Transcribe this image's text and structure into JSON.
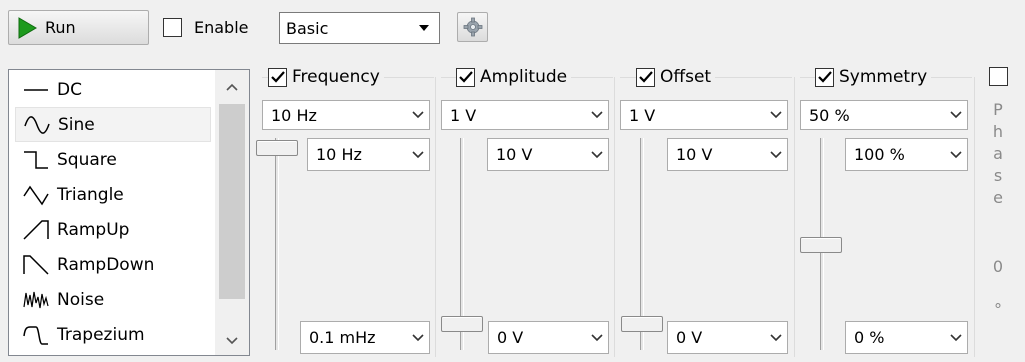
{
  "toolbar": {
    "run_label": "Run",
    "enable_label": "Enable",
    "enable_checked": false,
    "mode_value": "Basic"
  },
  "waveforms": {
    "items": [
      {
        "label": "DC",
        "icon": "dc-wave-icon",
        "selected": false
      },
      {
        "label": "Sine",
        "icon": "sine-wave-icon",
        "selected": true
      },
      {
        "label": "Square",
        "icon": "square-wave-icon",
        "selected": false
      },
      {
        "label": "Triangle",
        "icon": "triangle-wave-icon",
        "selected": false
      },
      {
        "label": "RampUp",
        "icon": "ramp-up-wave-icon",
        "selected": false
      },
      {
        "label": "RampDown",
        "icon": "ramp-down-wave-icon",
        "selected": false
      },
      {
        "label": "Noise",
        "icon": "noise-wave-icon",
        "selected": false
      },
      {
        "label": "Trapezium",
        "icon": "trapezium-wave-icon",
        "selected": false
      }
    ]
  },
  "params": {
    "frequency": {
      "label": "Frequency",
      "checked": true,
      "value": "10 Hz",
      "max": "10 Hz",
      "min": "0.1 mHz",
      "level": 1.0
    },
    "amplitude": {
      "label": "Amplitude",
      "checked": true,
      "value": "1 V",
      "max": "10 V",
      "min": "0 V",
      "level": 0.1
    },
    "offset": {
      "label": "Offset",
      "checked": true,
      "value": "1 V",
      "max": "10 V",
      "min": "0 V",
      "level": 0.1
    },
    "symmetry": {
      "label": "Symmetry",
      "checked": true,
      "value": "50 %",
      "max": "100 %",
      "min": "0 %",
      "level": 0.5
    }
  },
  "phase": {
    "checked": false,
    "letters": [
      "P",
      "h",
      "a",
      "s",
      "e"
    ],
    "value": "0",
    "unit": "°"
  },
  "colors": {
    "run_triangle": "#1d9a1d",
    "disabled_text": "#8a8a8a"
  }
}
